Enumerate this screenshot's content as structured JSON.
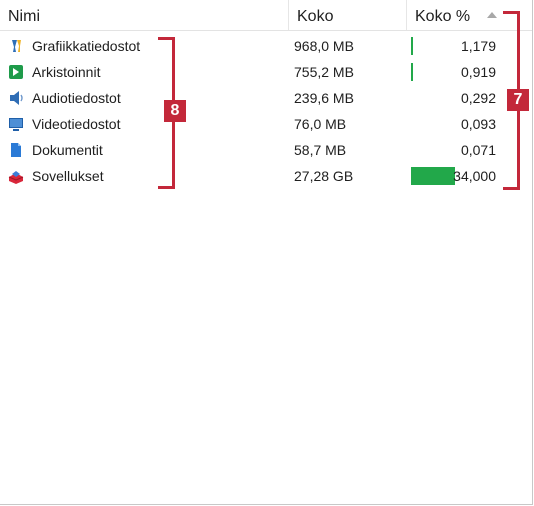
{
  "columns": {
    "name": "Nimi",
    "size": "Koko",
    "percent": "Koko %"
  },
  "rows": [
    {
      "name": "Grafiikkatiedostot",
      "size": "968,0 MB",
      "percent": "1,179",
      "bar_fraction": 0.0118,
      "icon": "graphics-icon"
    },
    {
      "name": "Arkistoinnit",
      "size": "755,2 MB",
      "percent": "0,919",
      "bar_fraction": 0.0092,
      "icon": "archive-icon"
    },
    {
      "name": "Audiotiedostot",
      "size": "239,6 MB",
      "percent": "0,292",
      "bar_fraction": 0.0029,
      "icon": "audio-icon"
    },
    {
      "name": "Videotiedostot",
      "size": "76,0 MB",
      "percent": "0,093",
      "bar_fraction": 0.0009,
      "icon": "video-icon"
    },
    {
      "name": "Dokumentit",
      "size": "58,7 MB",
      "percent": "0,071",
      "bar_fraction": 0.0007,
      "icon": "document-icon"
    },
    {
      "name": "Sovellukset",
      "size": "27,28 GB",
      "percent": "34,000",
      "bar_fraction": 0.34,
      "icon": "application-icon"
    }
  ],
  "callouts": {
    "left_badge": "8",
    "right_badge": "7"
  },
  "colors": {
    "bar": "#22a84a",
    "callout": "#c3283a"
  }
}
